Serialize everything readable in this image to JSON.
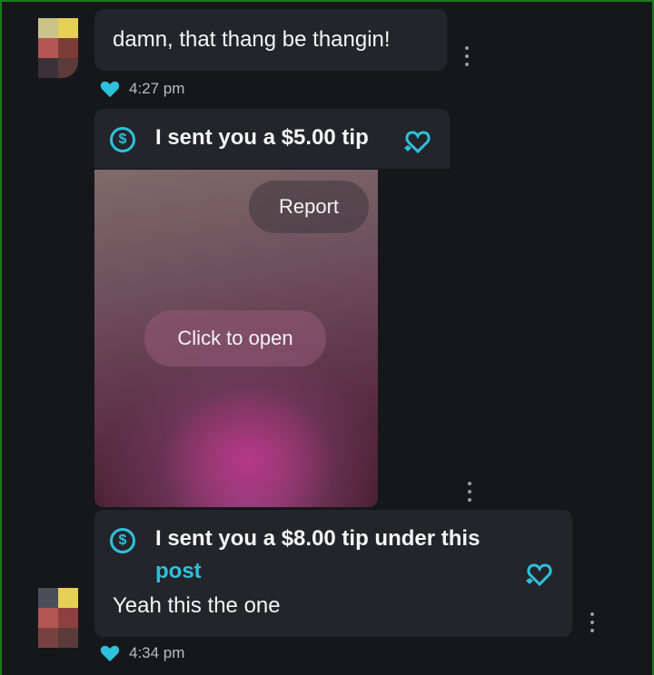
{
  "messages": [
    {
      "text": "damn, that thang be thangin!",
      "time": "4:27 pm"
    },
    {
      "tip_label": "I sent you a $5.00 tip",
      "currency_symbol": "$",
      "media": {
        "report_label": "Report",
        "open_label": "Click to open"
      }
    },
    {
      "tip_label_line1": "I sent you a $8.00 tip under this",
      "tip_link": "post",
      "currency_symbol": "$",
      "text": "Yeah this the one",
      "time": "4:34 pm"
    }
  ],
  "colors": {
    "accent": "#2ec1dd",
    "bubble": "#24252a",
    "background": "#16171b"
  }
}
